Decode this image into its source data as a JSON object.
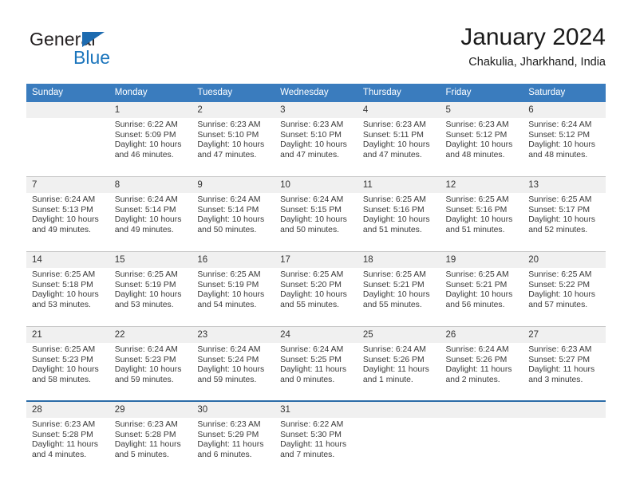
{
  "brand": {
    "name_top": "General",
    "name_bottom": "Blue",
    "triangle_color": "#1d6bb0",
    "blue_color": "#1b75bc"
  },
  "header": {
    "title": "January 2024",
    "location": "Chakulia, Jharkhand, India"
  },
  "theme": {
    "header_bg": "#3a7cbe",
    "daynum_bg": "#f0f0f0",
    "rule": "#c8c8c8",
    "rule_accent": "#2c6ca8"
  },
  "weekday_headers": [
    "Sunday",
    "Monday",
    "Tuesday",
    "Wednesday",
    "Thursday",
    "Friday",
    "Saturday"
  ],
  "weeks": [
    {
      "days": [
        {
          "num": "",
          "sunrise": "",
          "sunset": "",
          "daylight1": "",
          "daylight2": ""
        },
        {
          "num": "1",
          "sunrise": "Sunrise: 6:22 AM",
          "sunset": "Sunset: 5:09 PM",
          "daylight1": "Daylight: 10 hours",
          "daylight2": "and 46 minutes."
        },
        {
          "num": "2",
          "sunrise": "Sunrise: 6:23 AM",
          "sunset": "Sunset: 5:10 PM",
          "daylight1": "Daylight: 10 hours",
          "daylight2": "and 47 minutes."
        },
        {
          "num": "3",
          "sunrise": "Sunrise: 6:23 AM",
          "sunset": "Sunset: 5:10 PM",
          "daylight1": "Daylight: 10 hours",
          "daylight2": "and 47 minutes."
        },
        {
          "num": "4",
          "sunrise": "Sunrise: 6:23 AM",
          "sunset": "Sunset: 5:11 PM",
          "daylight1": "Daylight: 10 hours",
          "daylight2": "and 47 minutes."
        },
        {
          "num": "5",
          "sunrise": "Sunrise: 6:23 AM",
          "sunset": "Sunset: 5:12 PM",
          "daylight1": "Daylight: 10 hours",
          "daylight2": "and 48 minutes."
        },
        {
          "num": "6",
          "sunrise": "Sunrise: 6:24 AM",
          "sunset": "Sunset: 5:12 PM",
          "daylight1": "Daylight: 10 hours",
          "daylight2": "and 48 minutes."
        }
      ]
    },
    {
      "days": [
        {
          "num": "7",
          "sunrise": "Sunrise: 6:24 AM",
          "sunset": "Sunset: 5:13 PM",
          "daylight1": "Daylight: 10 hours",
          "daylight2": "and 49 minutes."
        },
        {
          "num": "8",
          "sunrise": "Sunrise: 6:24 AM",
          "sunset": "Sunset: 5:14 PM",
          "daylight1": "Daylight: 10 hours",
          "daylight2": "and 49 minutes."
        },
        {
          "num": "9",
          "sunrise": "Sunrise: 6:24 AM",
          "sunset": "Sunset: 5:14 PM",
          "daylight1": "Daylight: 10 hours",
          "daylight2": "and 50 minutes."
        },
        {
          "num": "10",
          "sunrise": "Sunrise: 6:24 AM",
          "sunset": "Sunset: 5:15 PM",
          "daylight1": "Daylight: 10 hours",
          "daylight2": "and 50 minutes."
        },
        {
          "num": "11",
          "sunrise": "Sunrise: 6:25 AM",
          "sunset": "Sunset: 5:16 PM",
          "daylight1": "Daylight: 10 hours",
          "daylight2": "and 51 minutes."
        },
        {
          "num": "12",
          "sunrise": "Sunrise: 6:25 AM",
          "sunset": "Sunset: 5:16 PM",
          "daylight1": "Daylight: 10 hours",
          "daylight2": "and 51 minutes."
        },
        {
          "num": "13",
          "sunrise": "Sunrise: 6:25 AM",
          "sunset": "Sunset: 5:17 PM",
          "daylight1": "Daylight: 10 hours",
          "daylight2": "and 52 minutes."
        }
      ]
    },
    {
      "days": [
        {
          "num": "14",
          "sunrise": "Sunrise: 6:25 AM",
          "sunset": "Sunset: 5:18 PM",
          "daylight1": "Daylight: 10 hours",
          "daylight2": "and 53 minutes."
        },
        {
          "num": "15",
          "sunrise": "Sunrise: 6:25 AM",
          "sunset": "Sunset: 5:19 PM",
          "daylight1": "Daylight: 10 hours",
          "daylight2": "and 53 minutes."
        },
        {
          "num": "16",
          "sunrise": "Sunrise: 6:25 AM",
          "sunset": "Sunset: 5:19 PM",
          "daylight1": "Daylight: 10 hours",
          "daylight2": "and 54 minutes."
        },
        {
          "num": "17",
          "sunrise": "Sunrise: 6:25 AM",
          "sunset": "Sunset: 5:20 PM",
          "daylight1": "Daylight: 10 hours",
          "daylight2": "and 55 minutes."
        },
        {
          "num": "18",
          "sunrise": "Sunrise: 6:25 AM",
          "sunset": "Sunset: 5:21 PM",
          "daylight1": "Daylight: 10 hours",
          "daylight2": "and 55 minutes."
        },
        {
          "num": "19",
          "sunrise": "Sunrise: 6:25 AM",
          "sunset": "Sunset: 5:21 PM",
          "daylight1": "Daylight: 10 hours",
          "daylight2": "and 56 minutes."
        },
        {
          "num": "20",
          "sunrise": "Sunrise: 6:25 AM",
          "sunset": "Sunset: 5:22 PM",
          "daylight1": "Daylight: 10 hours",
          "daylight2": "and 57 minutes."
        }
      ]
    },
    {
      "days": [
        {
          "num": "21",
          "sunrise": "Sunrise: 6:25 AM",
          "sunset": "Sunset: 5:23 PM",
          "daylight1": "Daylight: 10 hours",
          "daylight2": "and 58 minutes."
        },
        {
          "num": "22",
          "sunrise": "Sunrise: 6:24 AM",
          "sunset": "Sunset: 5:23 PM",
          "daylight1": "Daylight: 10 hours",
          "daylight2": "and 59 minutes."
        },
        {
          "num": "23",
          "sunrise": "Sunrise: 6:24 AM",
          "sunset": "Sunset: 5:24 PM",
          "daylight1": "Daylight: 10 hours",
          "daylight2": "and 59 minutes."
        },
        {
          "num": "24",
          "sunrise": "Sunrise: 6:24 AM",
          "sunset": "Sunset: 5:25 PM",
          "daylight1": "Daylight: 11 hours",
          "daylight2": "and 0 minutes."
        },
        {
          "num": "25",
          "sunrise": "Sunrise: 6:24 AM",
          "sunset": "Sunset: 5:26 PM",
          "daylight1": "Daylight: 11 hours",
          "daylight2": "and 1 minute."
        },
        {
          "num": "26",
          "sunrise": "Sunrise: 6:24 AM",
          "sunset": "Sunset: 5:26 PM",
          "daylight1": "Daylight: 11 hours",
          "daylight2": "and 2 minutes."
        },
        {
          "num": "27",
          "sunrise": "Sunrise: 6:23 AM",
          "sunset": "Sunset: 5:27 PM",
          "daylight1": "Daylight: 11 hours",
          "daylight2": "and 3 minutes."
        }
      ]
    },
    {
      "days": [
        {
          "num": "28",
          "sunrise": "Sunrise: 6:23 AM",
          "sunset": "Sunset: 5:28 PM",
          "daylight1": "Daylight: 11 hours",
          "daylight2": "and 4 minutes."
        },
        {
          "num": "29",
          "sunrise": "Sunrise: 6:23 AM",
          "sunset": "Sunset: 5:28 PM",
          "daylight1": "Daylight: 11 hours",
          "daylight2": "and 5 minutes."
        },
        {
          "num": "30",
          "sunrise": "Sunrise: 6:23 AM",
          "sunset": "Sunset: 5:29 PM",
          "daylight1": "Daylight: 11 hours",
          "daylight2": "and 6 minutes."
        },
        {
          "num": "31",
          "sunrise": "Sunrise: 6:22 AM",
          "sunset": "Sunset: 5:30 PM",
          "daylight1": "Daylight: 11 hours",
          "daylight2": "and 7 minutes."
        },
        {
          "num": "",
          "sunrise": "",
          "sunset": "",
          "daylight1": "",
          "daylight2": ""
        },
        {
          "num": "",
          "sunrise": "",
          "sunset": "",
          "daylight1": "",
          "daylight2": ""
        },
        {
          "num": "",
          "sunrise": "",
          "sunset": "",
          "daylight1": "",
          "daylight2": ""
        }
      ]
    }
  ]
}
